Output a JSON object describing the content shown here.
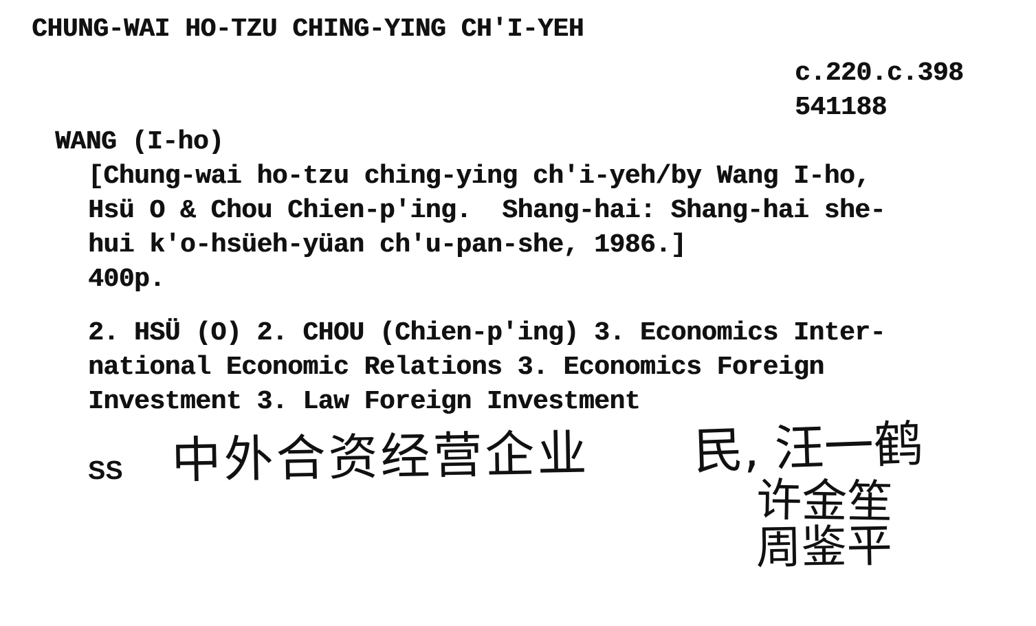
{
  "card": {
    "heading": "CHUNG-WAI HO-TZU CHING-YING CH'I-YEH",
    "shelfmark": "c.220.c.398",
    "accession_number": "541188",
    "author": "WANG (I-ho)",
    "title_lines": [
      "[Chung-wai ho-tzu ching-ying ch'i-yeh/by Wang I-ho,",
      "Hsü O & Chou Chien-p'ing.  Shang-hai: Shang-hai she-",
      "hui k'o-hsüeh-yüan ch'u-pan-she, 1986.]",
      "400p."
    ],
    "subject_lines": [
      "2. HSÜ (O) 2. CHOU (Chien-p'ing) 3. Economics Inter-",
      "national Economic Relations 3. Economics Foreign",
      "Investment 3. Law Foreign Investment"
    ],
    "ss_label": "SS",
    "handwritten_notes": {
      "title_chars": "中外合资经营企业",
      "names_line1": "民, 汪一鹤",
      "names_line2": "许金笙",
      "names_line3": "周鉴平"
    }
  }
}
